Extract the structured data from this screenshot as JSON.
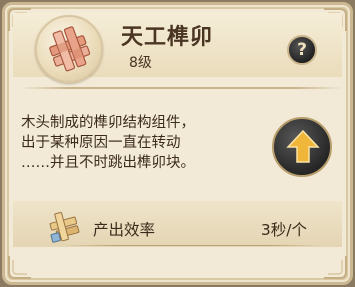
{
  "item": {
    "name": "天工榫卯",
    "level": "8级",
    "icon": "mortise-tenon-icon",
    "description_lines": [
      "木头制成的榫卯结构组件，",
      "出于某种原因一直在转动",
      "……并且不时跳出榫卯块。"
    ]
  },
  "buttons": {
    "help_glyph": "?",
    "upgrade_icon": "up-arrow-icon"
  },
  "stats": {
    "label": "产出效率",
    "value": "3秒/个",
    "icon": "wood-block-icon"
  },
  "colors": {
    "panel": "#f2ead7",
    "border": "#cbb892",
    "text": "#3c2b1c",
    "accent_arrow": "#f0b63a",
    "button_dark": "#222222"
  }
}
